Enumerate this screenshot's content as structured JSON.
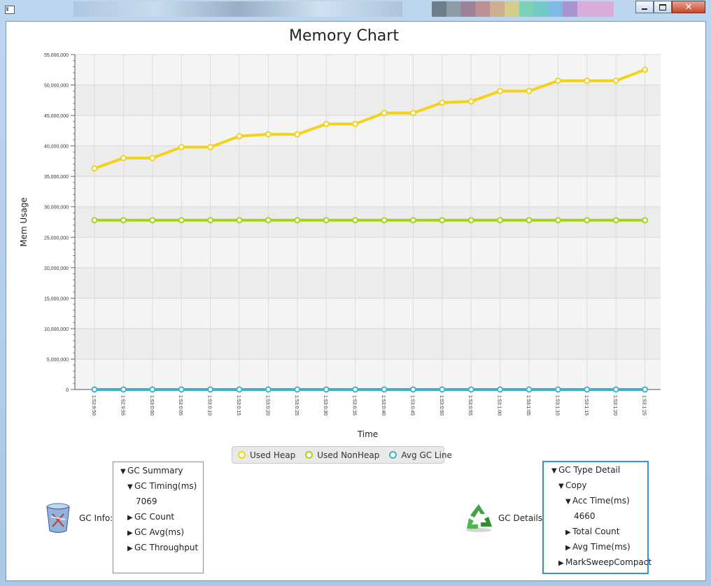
{
  "window": {
    "title": ""
  },
  "chart_data": {
    "type": "line",
    "title": "Memory Chart",
    "xlabel": "Time",
    "ylabel": "Mem Usage",
    "ylim": [
      0,
      55000000
    ],
    "yticks": [
      "0",
      "5,000,000",
      "10,000,000",
      "15,000,000",
      "20,000,000",
      "25,000,000",
      "30,000,000",
      "35,000,000",
      "40,000,000",
      "45,000,000",
      "50,000,000",
      "55,000,000"
    ],
    "categories": [
      "1:52:9:50",
      "1:52:9:55",
      "1:53:0:00",
      "1:53:0:05",
      "1:53:0:10",
      "1:53:0:15",
      "1:53:0:20",
      "1:53:0:25",
      "1:53:0:30",
      "1:53:0:35",
      "1:53:0:40",
      "1:53:0:45",
      "1:53:0:50",
      "1:53:0:55",
      "1:53:1:00",
      "1:53:1:05",
      "1:53:1:10",
      "1:53:1:15",
      "1:53:1:20",
      "1:53:1:25"
    ],
    "grid": true,
    "legend": "bottom-center",
    "series": [
      {
        "name": "Used Heap",
        "color": "#f2d21a",
        "values": [
          36300000,
          38000000,
          38000000,
          39800000,
          39800000,
          41600000,
          41900000,
          41900000,
          43600000,
          43600000,
          45400000,
          45400000,
          47100000,
          47300000,
          49000000,
          49000000,
          50700000,
          50700000,
          50700000,
          52500000
        ]
      },
      {
        "name": "Used NonHeap",
        "color": "#a5d41a",
        "values": [
          27800000,
          27800000,
          27800000,
          27800000,
          27800000,
          27800000,
          27800000,
          27800000,
          27800000,
          27800000,
          27800000,
          27800000,
          27800000,
          27800000,
          27800000,
          27800000,
          27800000,
          27800000,
          27800000,
          27800000
        ]
      },
      {
        "name": "Avg GC Line",
        "color": "#3fb2c6",
        "values": [
          0,
          0,
          0,
          0,
          0,
          0,
          0,
          0,
          0,
          0,
          0,
          0,
          0,
          0,
          0,
          0,
          0,
          0,
          0,
          0
        ]
      }
    ]
  },
  "gc_info": {
    "label": "GC Info:",
    "tree": [
      {
        "label": "GC Summary",
        "expanded": true,
        "depth": 0
      },
      {
        "label": "GC Timing(ms)",
        "expanded": true,
        "depth": 1
      },
      {
        "label": "7069",
        "leaf": true,
        "depth": 2
      },
      {
        "label": "GC Count",
        "expanded": false,
        "depth": 1
      },
      {
        "label": "GC Avg(ms)",
        "expanded": false,
        "depth": 1
      },
      {
        "label": "GC Throughput",
        "expanded": false,
        "depth": 1
      }
    ]
  },
  "gc_details": {
    "label": "GC Details:",
    "tree": [
      {
        "label": "GC Type Detail",
        "expanded": true,
        "depth": 0
      },
      {
        "label": "Copy",
        "expanded": true,
        "depth": 1
      },
      {
        "label": "Acc Time(ms)",
        "expanded": true,
        "depth": 2
      },
      {
        "label": "4660",
        "leaf": true,
        "depth": 3
      },
      {
        "label": "Total Count",
        "expanded": false,
        "depth": 2
      },
      {
        "label": "Avg Time(ms)",
        "expanded": false,
        "depth": 2
      },
      {
        "label": "MarkSweepCompact",
        "expanded": false,
        "depth": 1
      }
    ]
  },
  "icons": {
    "gc_info": "recycle-bin-icon",
    "gc_details": "recycle-icon"
  }
}
